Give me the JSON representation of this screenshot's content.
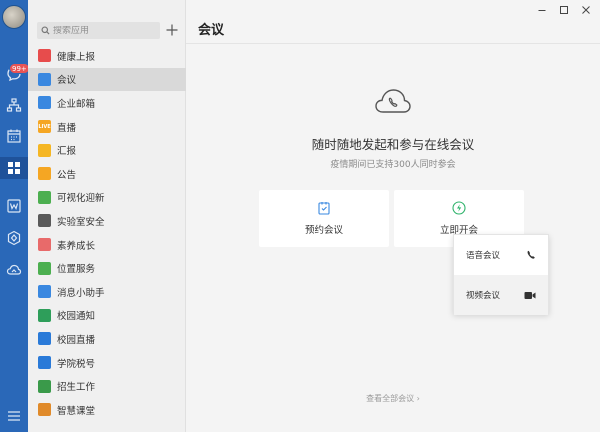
{
  "rail": {
    "badge": "99+"
  },
  "sidebar": {
    "search_placeholder": "搜索应用",
    "apps": [
      {
        "label": "健康上报",
        "icon": "health-report-icon",
        "color": "#e74c4c"
      },
      {
        "label": "会议",
        "icon": "meeting-cloud-icon",
        "color": "#3a88e0",
        "selected": true
      },
      {
        "label": "企业邮箱",
        "icon": "mail-icon",
        "color": "#3a88e0"
      },
      {
        "label": "直播",
        "icon": "live-icon",
        "color": "#f5a623",
        "glyph": "LIVE"
      },
      {
        "label": "汇报",
        "icon": "report-icon",
        "color": "#f5b623"
      },
      {
        "label": "公告",
        "icon": "announcement-icon",
        "color": "#f5a623"
      },
      {
        "label": "可视化迎新",
        "icon": "welcome-icon",
        "color": "#4caf50"
      },
      {
        "label": "实验室安全",
        "icon": "lab-safety-icon",
        "color": "#5a5a5a"
      },
      {
        "label": "素养成长",
        "icon": "growth-icon",
        "color": "#e86a6a"
      },
      {
        "label": "位置服务",
        "icon": "location-icon",
        "color": "#4caf50"
      },
      {
        "label": "消息小助手",
        "icon": "message-assistant-icon",
        "color": "#3a88e0"
      },
      {
        "label": "校园通知",
        "icon": "campus-notice-icon",
        "color": "#2e9e5a"
      },
      {
        "label": "校园直播",
        "icon": "campus-live-icon",
        "color": "#2a7ad8"
      },
      {
        "label": "学院税号",
        "icon": "tax-id-icon",
        "color": "#2a7ad8"
      },
      {
        "label": "招生工作",
        "icon": "admission-icon",
        "color": "#3a9a4a"
      },
      {
        "label": "智慧课堂",
        "icon": "smart-classroom-icon",
        "color": "#e08a2a"
      }
    ]
  },
  "main": {
    "title": "会议",
    "headline": "随时随地发起和参与在线会议",
    "subline": "疫情期间已支持300人同时参会",
    "cards": [
      {
        "label": "预约会议",
        "icon": "schedule-icon"
      },
      {
        "label": "立即开会",
        "icon": "start-now-icon"
      }
    ],
    "dropdown": [
      {
        "label": "语音会议",
        "icon": "phone-icon"
      },
      {
        "label": "视频会议",
        "icon": "video-camera-icon"
      }
    ],
    "view_all": "查看全部会议  ›"
  },
  "colors": {
    "rail": "#2a68b8",
    "accent": "#3a88e0",
    "start_icon": "#2fb36b",
    "schedule_icon": "#3a88e0"
  }
}
